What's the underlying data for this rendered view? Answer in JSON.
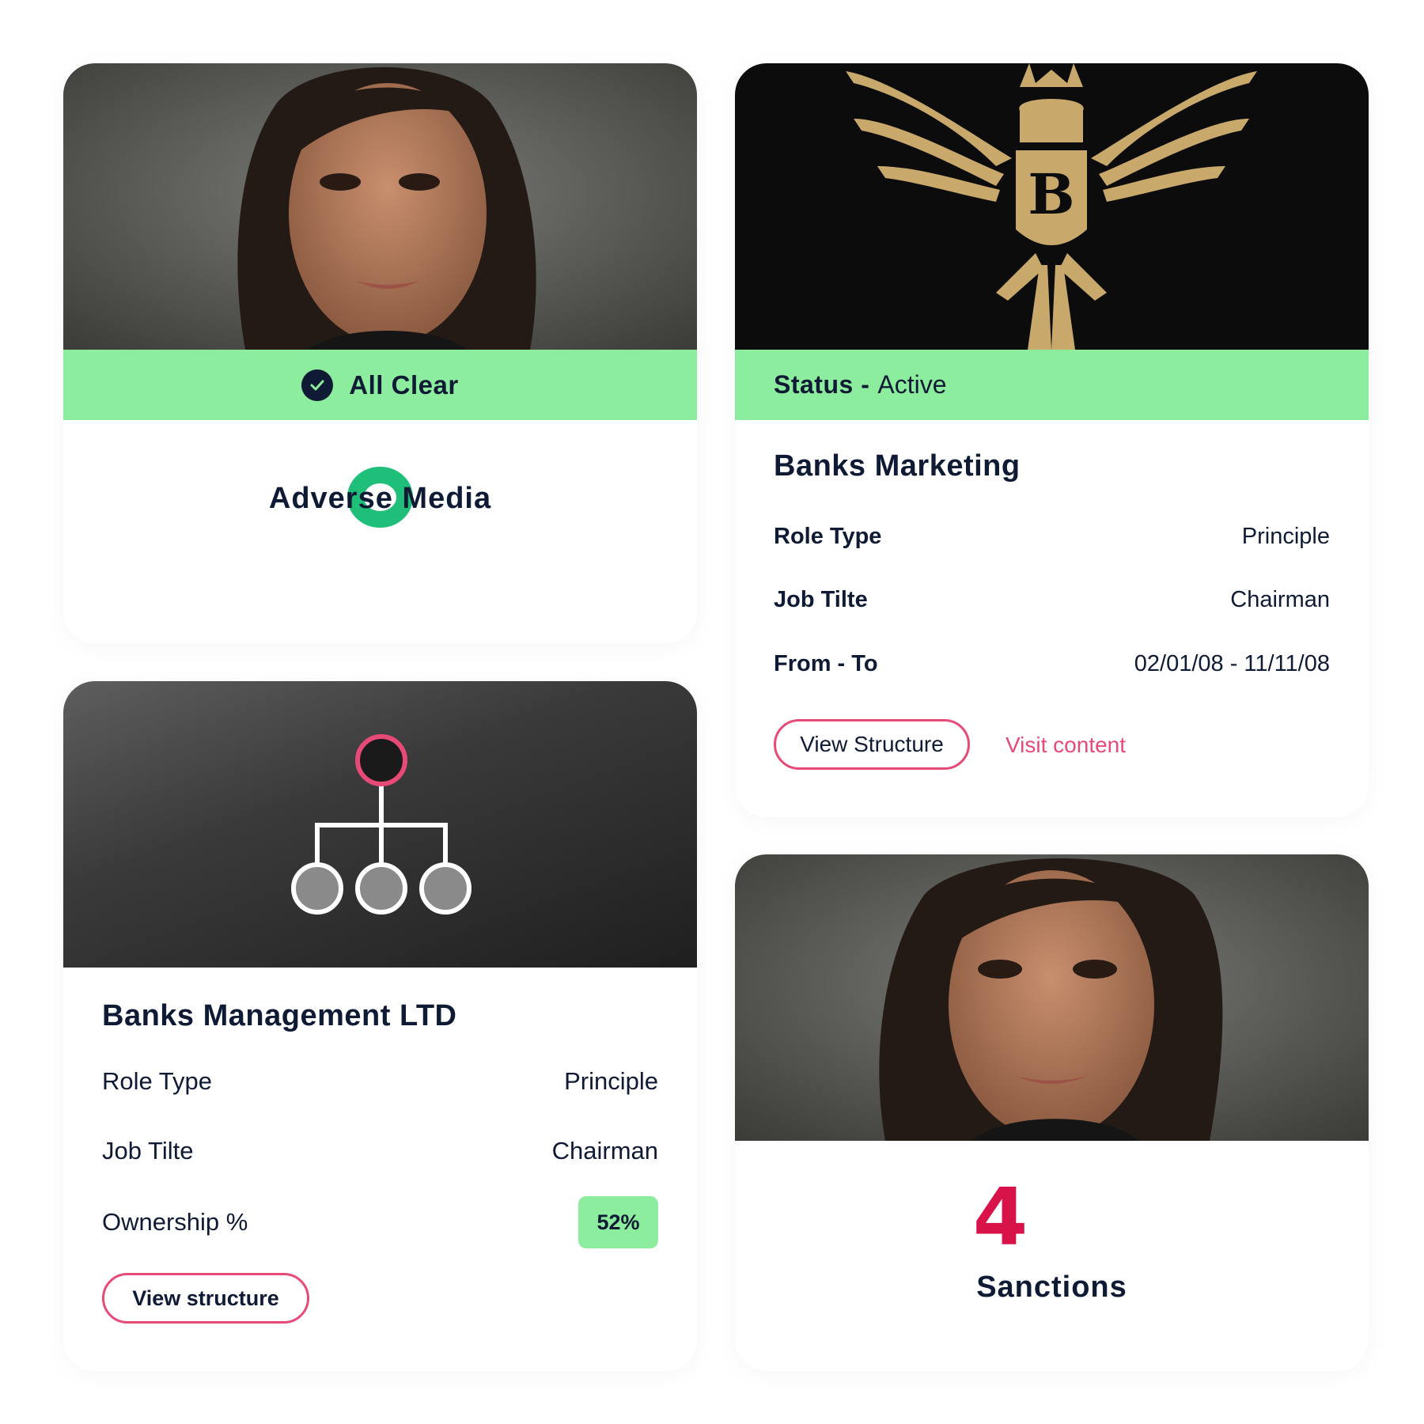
{
  "card_adverse": {
    "banner_label": "All Clear",
    "count": "0",
    "label": "Adverse Media",
    "icon": "check-circle-icon"
  },
  "card_company_marketing": {
    "status_key": "Status -",
    "status_value": "Active",
    "title": "Banks Marketing",
    "rows": [
      {
        "key": "Role Type",
        "value": "Principle"
      },
      {
        "key": "Job Tilte",
        "value": "Chairman"
      },
      {
        "key": "From - To",
        "value": "02/01/08 - 11/11/08"
      }
    ],
    "button_label": "View Structure",
    "link_label": "Visit content",
    "logo_letter": "B"
  },
  "card_company_management": {
    "title": "Banks Management LTD",
    "rows": [
      {
        "key": "Role Type",
        "value": "Principle"
      },
      {
        "key": "Job Tilte",
        "value": "Chairman"
      },
      {
        "key": "Ownership %",
        "value": "52%"
      }
    ],
    "button_label": "View structure",
    "icon": "org-chart-icon"
  },
  "card_sanctions": {
    "count": "4",
    "label": "Sanctions"
  },
  "colors": {
    "accent_green": "#8ded9e",
    "zero_green": "#1fbf7a",
    "sanction_red": "#d8134a",
    "button_pink": "#e84a78",
    "text_navy": "#0f1b35"
  }
}
